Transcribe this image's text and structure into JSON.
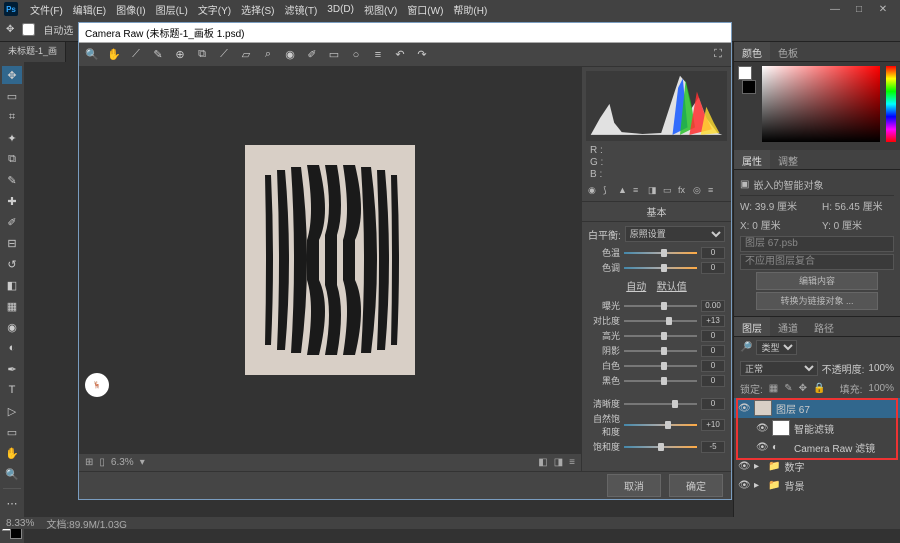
{
  "menu": {
    "items": [
      "文件(F)",
      "编辑(E)",
      "图像(I)",
      "图层(L)",
      "文字(Y)",
      "选择(S)",
      "滤镜(T)",
      "3D(D)",
      "视图(V)",
      "窗口(W)",
      "帮助(H)"
    ]
  },
  "optbar": {
    "auto": "自动选"
  },
  "doctab": "未标题-1_画",
  "crw": {
    "title": "Camera Raw (未标题-1_画板 1.psd)",
    "rgb": {
      "r": "R :",
      "g": "G :",
      "b": "B :"
    },
    "panel": "基本",
    "wb": {
      "label": "白平衡:",
      "value": "原照设置"
    },
    "sliders": [
      {
        "label": "色温",
        "val": "0",
        "pos": 50,
        "gray": false
      },
      {
        "label": "色调",
        "val": "0",
        "pos": 50,
        "gray": false
      }
    ],
    "auto": {
      "a": "自动",
      "b": "默认值"
    },
    "sliders2": [
      {
        "label": "曝光",
        "val": "0.00",
        "pos": 50
      },
      {
        "label": "对比度",
        "val": "+13",
        "pos": 57
      },
      {
        "label": "高光",
        "val": "0",
        "pos": 50
      },
      {
        "label": "阴影",
        "val": "0",
        "pos": 50
      },
      {
        "label": "白色",
        "val": "0",
        "pos": 50
      },
      {
        "label": "黑色",
        "val": "0",
        "pos": 50
      }
    ],
    "sliders3": [
      {
        "label": "清晰度",
        "val": "0",
        "pos": 66
      },
      {
        "label": "自然饱和度",
        "val": "+10",
        "pos": 56,
        "gray": false
      },
      {
        "label": "饱和度",
        "val": "-5",
        "pos": 47,
        "gray": false
      }
    ],
    "zoom": "6.3%",
    "buttons": {
      "cancel": "取消",
      "ok": "确定"
    }
  },
  "rcol": {
    "color_tabs": [
      "颜色",
      "色板"
    ],
    "prop_tabs": [
      "属性",
      "调整"
    ],
    "smart": "嵌入的智能对象",
    "w": "W: 39.9 厘米",
    "h": "H: 56.45 厘米",
    "x": "X: 0 厘米",
    "y": "Y: 0 厘米",
    "layerfile": "图层 67.psb",
    "warn": "不应用图层复合",
    "btn1": "编辑内容",
    "btn2": "转换为链接对象 ...",
    "layer_tabs": [
      "图层",
      "通道",
      "路径"
    ],
    "kind": "类型",
    "blend": "正常",
    "opacity_l": "不透明度:",
    "opacity": "100%",
    "fill_l": "填充:",
    "fill": "100%",
    "lock": "锁定:",
    "layers": [
      {
        "name": "图层 67",
        "sel": true,
        "indent": 0,
        "thumb": "art"
      },
      {
        "name": "智能滤镜",
        "sel": false,
        "indent": 1,
        "thumb": "sf"
      },
      {
        "name": "Camera Raw 滤镜",
        "sel": false,
        "indent": 1,
        "thumb": "none"
      },
      {
        "name": "数字",
        "sel": false,
        "indent": 0,
        "thumb": "folder"
      },
      {
        "name": "背景",
        "sel": false,
        "indent": 0,
        "thumb": "folder"
      }
    ]
  },
  "status": {
    "zoom": "8.33%",
    "doc": "文档:89.9M/1.03G"
  }
}
